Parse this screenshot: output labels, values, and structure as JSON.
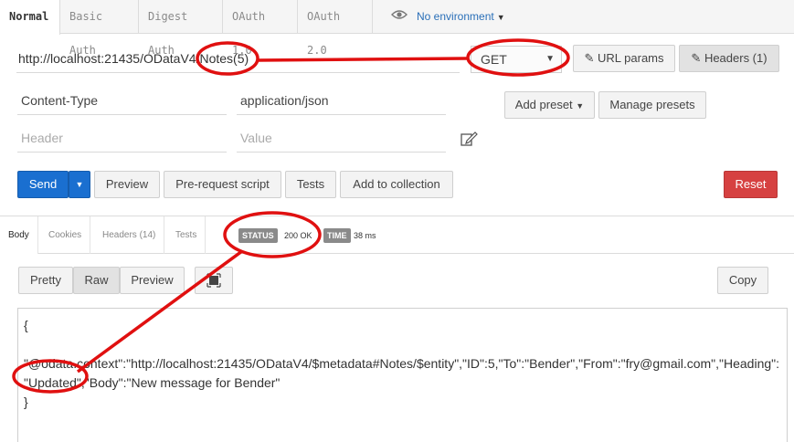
{
  "auth_tabs": [
    "Normal",
    "Basic Auth",
    "Digest Auth",
    "OAuth 1.0",
    "OAuth 2.0"
  ],
  "environment": {
    "label": "No environment",
    "icon": "eye-icon"
  },
  "request": {
    "url": "http://localhost:21435/ODataV4/Notes(5)",
    "method": "GET",
    "url_params_label": "URL params",
    "headers_label": "Headers (1)"
  },
  "headers": {
    "key_value": "Content-Type",
    "value_value": "application/json",
    "key_placeholder": "Header",
    "value_placeholder": "Value",
    "add_preset_label": "Add preset",
    "manage_presets_label": "Manage presets"
  },
  "actions": {
    "send": "Send",
    "preview": "Preview",
    "prerequest": "Pre-request script",
    "tests": "Tests",
    "add_to_collection": "Add to collection",
    "reset": "Reset"
  },
  "response_tabs": [
    "Body",
    "Cookies",
    "Headers (14)",
    "Tests"
  ],
  "status": {
    "label": "STATUS",
    "value": "200 OK",
    "time_label": "TIME",
    "time_value": "38 ms"
  },
  "view": {
    "pretty": "Pretty",
    "raw": "Raw",
    "preview": "Preview",
    "copy": "Copy"
  },
  "body": {
    "open": "{",
    "line1": "\"@odata.context\":\"http://localhost:21435/ODataV4/$metadata#Notes/$entity\",\"ID\":5,\"To\":\"Bender\",\"From\":\"fry@gmail.com\",\"Heading\":",
    "line2": "\"Updated\",\"Body\":\"New message for Bender\"",
    "close": "}"
  },
  "colors": {
    "accent_blue": "#1a6fd0",
    "danger_red": "#d64141",
    "annotation_red": "#e01010"
  }
}
